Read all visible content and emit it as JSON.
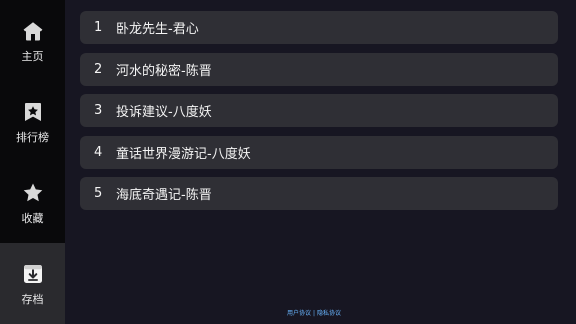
{
  "sidebar": {
    "items": [
      {
        "label": "主页",
        "icon": "home-icon"
      },
      {
        "label": "排行榜",
        "icon": "ranking-icon"
      },
      {
        "label": "收藏",
        "icon": "star-icon"
      },
      {
        "label": "存档",
        "icon": "archive-icon"
      }
    ],
    "active_index": 3
  },
  "main": {
    "items": [
      {
        "index": "1",
        "title": "卧龙先生-君心"
      },
      {
        "index": "2",
        "title": "河水的秘密-陈晋"
      },
      {
        "index": "3",
        "title": "投诉建议-八度妖"
      },
      {
        "index": "4",
        "title": "童话世界漫游记-八度妖"
      },
      {
        "index": "5",
        "title": "海底奇遇记-陈晋"
      }
    ]
  },
  "footer": {
    "user_agreement": "用户协议",
    "separator": "|",
    "privacy_policy": "隐私协议"
  },
  "colors": {
    "background": "#171622",
    "sidebar_background": "#09090b",
    "sidebar_active_background": "#2a2a2e",
    "card_background": "#2f2f35",
    "text": "#f4f4f4",
    "link": "#69b6ff"
  }
}
